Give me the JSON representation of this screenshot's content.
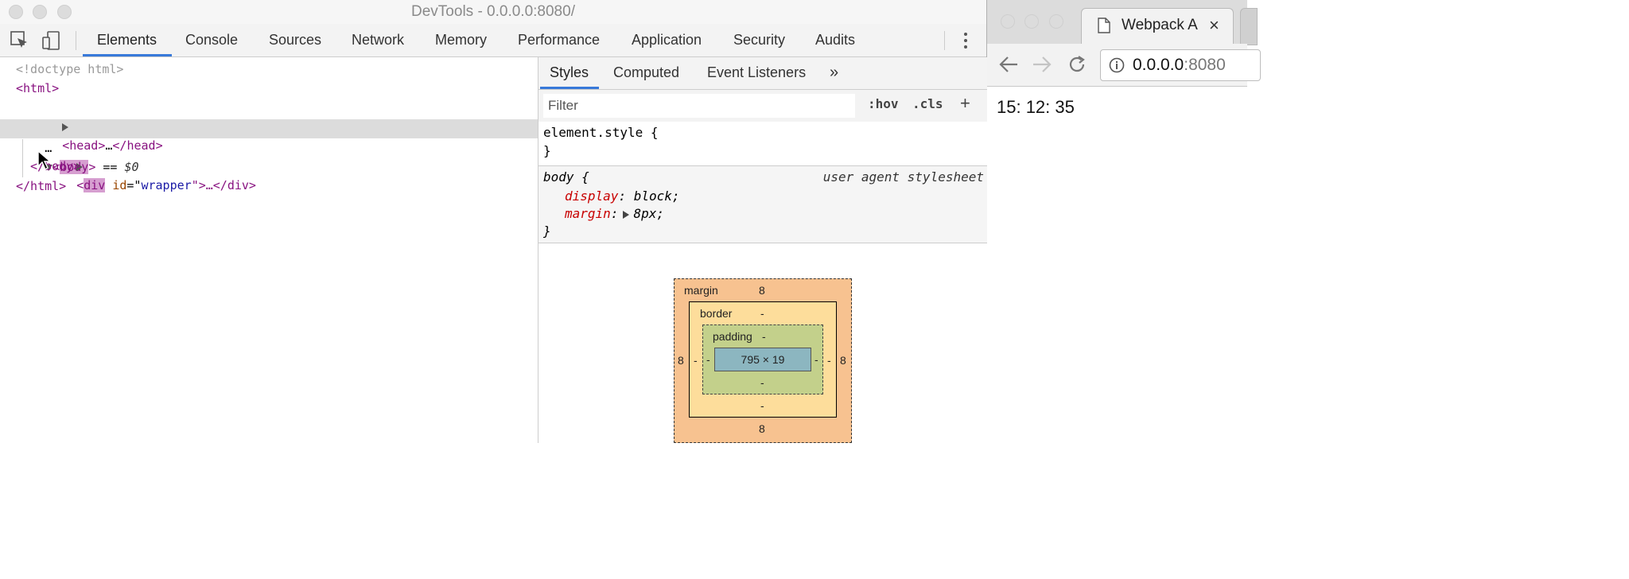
{
  "window": {
    "title": "DevTools - 0.0.0.0:8080/"
  },
  "toolbar": {
    "tabs": [
      "Elements",
      "Console",
      "Sources",
      "Network",
      "Memory",
      "Performance",
      "Application",
      "Security",
      "Audits"
    ],
    "active_tab": "Elements"
  },
  "dom": {
    "doctype": "<!doctype html>",
    "html_open": "<html>",
    "head": {
      "open": "<head>",
      "ellipsis": "…",
      "close": "</head>"
    },
    "body": {
      "lt": "<",
      "name": "body",
      "gt": ">",
      "eq": " == ",
      "ref": "$0"
    },
    "div": {
      "lt": "<",
      "name": "div",
      "attr_name": "id",
      "eq": "=\"",
      "attr_value": "wrapper",
      "rest": "\">…</div>"
    },
    "body_close": "</body>",
    "html_close": "</html>",
    "dots": "…"
  },
  "styles_panel": {
    "subtabs": [
      "Styles",
      "Computed",
      "Event Listeners"
    ],
    "more": "»",
    "filter_placeholder": "Filter",
    "hov": ":hov",
    "cls": ".cls",
    "plus": "+",
    "rule1": {
      "selector": "element.style",
      "open": " {",
      "close": "}"
    },
    "rule2": {
      "selector": "body",
      "open": " {",
      "source": "user agent stylesheet",
      "props": [
        {
          "name": "display",
          "value": "block"
        },
        {
          "name": "margin",
          "value": "8px"
        }
      ],
      "close": "}"
    },
    "box_model": {
      "margin_label": "margin",
      "border_label": "border",
      "padding_label": "padding",
      "margin_top": "8",
      "margin_bottom": "8",
      "margin_left": "8",
      "margin_right": "8",
      "border_top": "-",
      "border_bottom": "-",
      "border_left": "-",
      "border_right": "-",
      "padding_top": "-",
      "padding_bottom": "-",
      "padding_left": "-",
      "padding_right": "-",
      "content": "795 × 19"
    }
  },
  "browser": {
    "tab_title": "Webpack Ap",
    "close": "×",
    "url_host": "0.0.0.0",
    "url_port": ":8080",
    "page_text": "15: 12: 35"
  }
}
